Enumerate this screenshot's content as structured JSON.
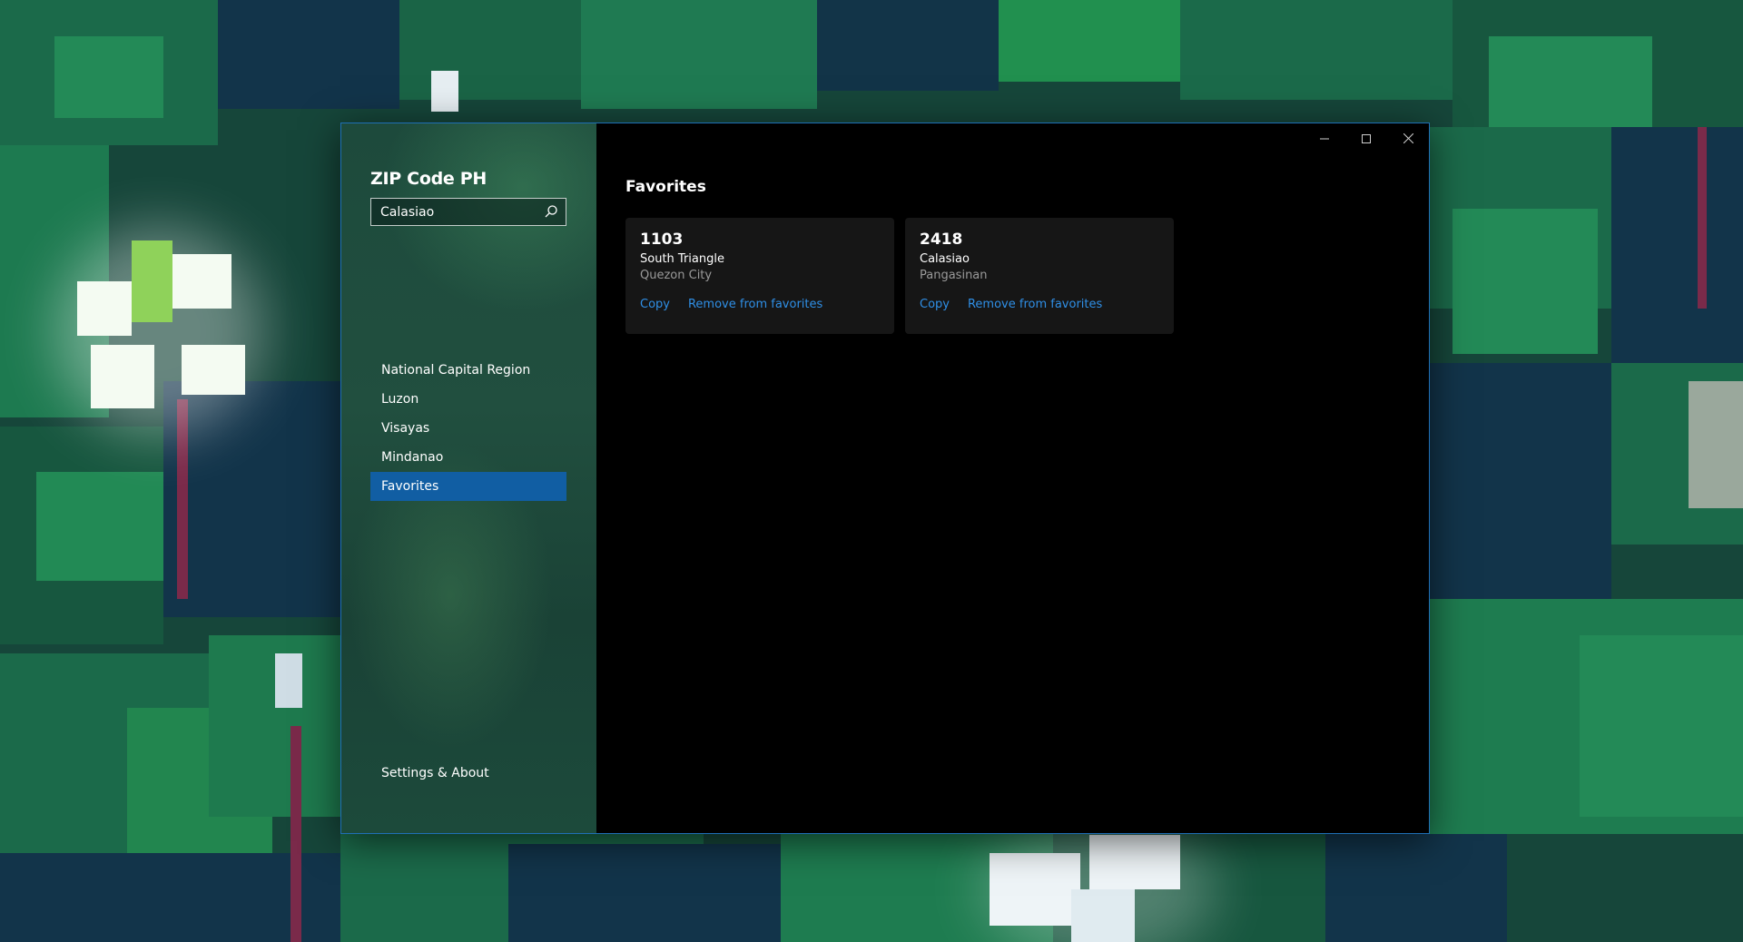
{
  "app": {
    "title": "ZIP Code PH"
  },
  "search": {
    "value": "Calasiao",
    "icon": "search-icon"
  },
  "sidebar": {
    "items": [
      {
        "label": "National Capital Region",
        "selected": false
      },
      {
        "label": "Luzon",
        "selected": false
      },
      {
        "label": "Visayas",
        "selected": false
      },
      {
        "label": "Mindanao",
        "selected": false
      },
      {
        "label": "Favorites",
        "selected": true
      }
    ],
    "footer_label": "Settings & About"
  },
  "window_controls": {
    "minimize": "minimize-icon",
    "maximize": "maximize-icon",
    "close": "close-icon"
  },
  "main": {
    "title": "Favorites",
    "cards": [
      {
        "code": "1103",
        "name": "South Triangle",
        "area": "Quezon City",
        "copy_label": "Copy",
        "remove_label": "Remove from favorites"
      },
      {
        "code": "2418",
        "name": "Calasiao",
        "area": "Pangasinan",
        "copy_label": "Copy",
        "remove_label": "Remove from favorites"
      }
    ]
  },
  "colors": {
    "accent": "#115ea3",
    "link": "#2f8fe6",
    "window_border": "#1f6fb5",
    "content_bg": "#000000",
    "card_bg": "#161616"
  }
}
